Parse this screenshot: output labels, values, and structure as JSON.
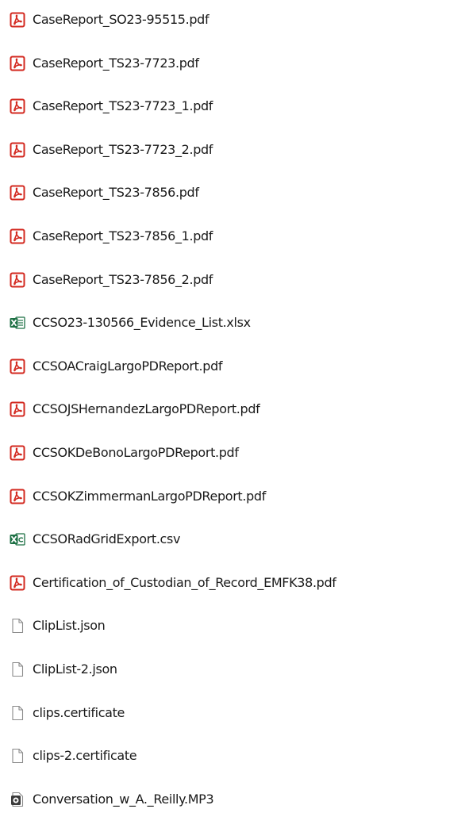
{
  "files": [
    {
      "name": "CaseReport_SO23-95515.pdf",
      "icon": "pdf-icon"
    },
    {
      "name": "CaseReport_TS23-7723.pdf",
      "icon": "pdf-icon"
    },
    {
      "name": "CaseReport_TS23-7723_1.pdf",
      "icon": "pdf-icon"
    },
    {
      "name": "CaseReport_TS23-7723_2.pdf",
      "icon": "pdf-icon"
    },
    {
      "name": "CaseReport_TS23-7856.pdf",
      "icon": "pdf-icon"
    },
    {
      "name": "CaseReport_TS23-7856_1.pdf",
      "icon": "pdf-icon"
    },
    {
      "name": "CaseReport_TS23-7856_2.pdf",
      "icon": "pdf-icon"
    },
    {
      "name": "CCSO23-130566_Evidence_List.xlsx",
      "icon": "excel-icon"
    },
    {
      "name": "CCSOACraigLargoPDReport.pdf",
      "icon": "pdf-icon"
    },
    {
      "name": "CCSOJSHernandezLargoPDReport.pdf",
      "icon": "pdf-icon"
    },
    {
      "name": "CCSOKDeBonoLargoPDReport.pdf",
      "icon": "pdf-icon"
    },
    {
      "name": "CCSOKZimmermanLargoPDReport.pdf",
      "icon": "pdf-icon"
    },
    {
      "name": "CCSORadGridExport.csv",
      "icon": "excel-csv-icon"
    },
    {
      "name": "Certification_of_Custodian_of_Record_EMFK38.pdf",
      "icon": "pdf-icon"
    },
    {
      "name": "ClipList.json",
      "icon": "blank-file-icon"
    },
    {
      "name": "ClipList-2.json",
      "icon": "blank-file-icon"
    },
    {
      "name": "clips.certificate",
      "icon": "blank-file-icon"
    },
    {
      "name": "clips-2.certificate",
      "icon": "blank-file-icon"
    },
    {
      "name": "Conversation_w_A._Reilly.MP3",
      "icon": "audio-file-icon"
    }
  ],
  "colors": {
    "pdf_red": "#d3281f",
    "excel_green": "#1e7145",
    "blank_gray": "#8a8a8a",
    "audio_dark": "#3b3b3b"
  }
}
